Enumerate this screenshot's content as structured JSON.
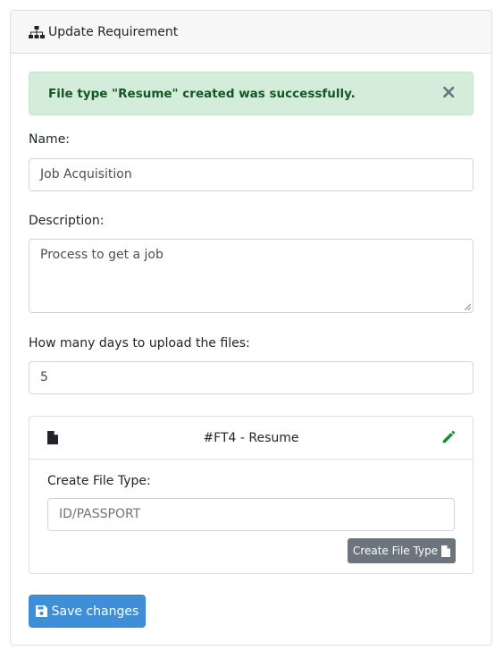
{
  "header": {
    "title": "Update Requirement",
    "icon": "sitemap-icon"
  },
  "alert": {
    "message": "File type \"Resume\" created was successfully.",
    "close_label": "×"
  },
  "form": {
    "name_label": "Name:",
    "name_value": "Job Acquisition",
    "description_label": "Description:",
    "description_value": "Process to get a job",
    "days_label": "How many days to upload the files:",
    "days_value": "5"
  },
  "file_type_panel": {
    "title": "#FT4 - Resume",
    "create_label": "Create File Type:",
    "create_placeholder": "ID/PASSPORT",
    "create_button": "Create File Type"
  },
  "save_button": "Save changes",
  "colors": {
    "alert_bg": "#d4edda",
    "alert_text": "#155724",
    "edit_icon": "#1e8a36",
    "primary": "#3f8ed8",
    "secondary": "#6c757d"
  }
}
